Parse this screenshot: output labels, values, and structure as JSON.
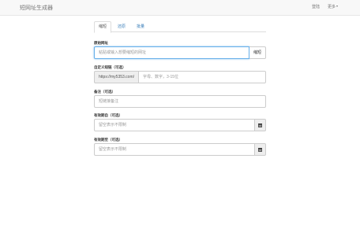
{
  "navbar": {
    "brand": "短网址生成器",
    "links": [
      "登陆",
      "更多"
    ]
  },
  "tabs": [
    "缩短",
    "还原",
    "批量"
  ],
  "form": {
    "url": {
      "label": "原始网址",
      "placeholder": "粘贴或输入想要缩短的网址",
      "button": "缩短"
    },
    "custom": {
      "label": "自定义短链（可选）",
      "prefix": "https://my5353.com/",
      "placeholder": "字母、数字，3-15位"
    },
    "note": {
      "label": "备注（可选）",
      "placeholder": "短链接备注"
    },
    "start": {
      "label": "有效期自（可选）",
      "placeholder": "留空表示不限制",
      "icon": "calendar-icon"
    },
    "end": {
      "label": "有效期至（可选）",
      "placeholder": "留空表示不限制",
      "icon": "calendar-icon"
    }
  }
}
